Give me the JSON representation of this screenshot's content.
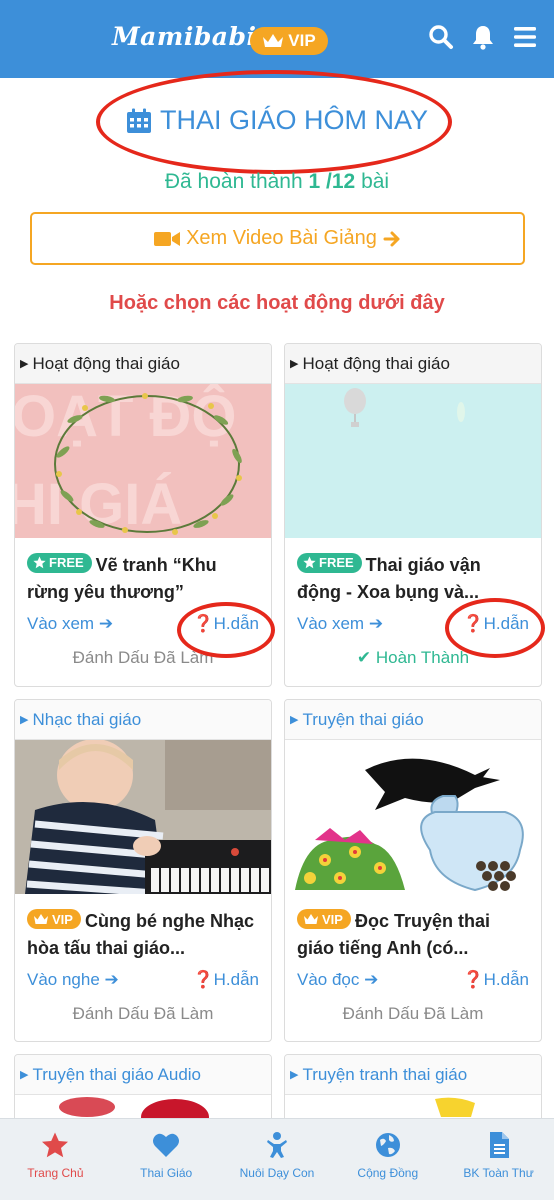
{
  "header": {
    "logo": "Mamibabi",
    "vip_label": "VIP",
    "icons": [
      "search-icon",
      "bell-icon",
      "menu-icon"
    ],
    "color": "#3d8fd9"
  },
  "today": {
    "title": "THAI GIÁO HÔM NAY",
    "progress_prefix": "Đã hoàn thành",
    "progress_value": "1 /12",
    "progress_suffix": "bài",
    "video_button": "Xem Video Bài Giảng",
    "choose_text": "Hoặc chọn các hoạt động dưới đây"
  },
  "cards": [
    {
      "category": "Hoạt động thai giáo",
      "badge": "FREE",
      "title": "Vẽ tranh “Khu rừng yêu thương”",
      "action": "Vào xem",
      "guide": "H.dẫn",
      "mark": "Đánh Dấu Đã Làm"
    },
    {
      "category": "Hoạt động thai giáo",
      "badge": "FREE",
      "title": "Thai giáo vận động - Xoa bụng và...",
      "action": "Vào xem",
      "guide": "H.dẫn",
      "mark": "Hoàn Thành"
    },
    {
      "category": "Nhạc thai giáo",
      "badge": "VIP",
      "title": "Cùng bé nghe Nhạc hòa tấu thai giáo...",
      "action": "Vào nghe",
      "guide": "H.dẫn",
      "mark": "Đánh Dấu Đã Làm"
    },
    {
      "category": "Truyện thai giáo",
      "badge": "VIP",
      "title": "Đọc Truyện thai giáo tiếng Anh (có...",
      "action": "Vào đọc",
      "guide": "H.dẫn",
      "mark": "Đánh Dấu Đã Làm"
    },
    {
      "category": "Truyện thai giáo Audio"
    },
    {
      "category": "Truyện tranh thai giáo"
    }
  ],
  "bottom_nav": [
    {
      "label": "Trang Chủ",
      "icon": "star-icon",
      "active": true
    },
    {
      "label": "Thai Giáo",
      "icon": "heart-icon"
    },
    {
      "label": "Nuôi Dạy Con",
      "icon": "baby-icon"
    },
    {
      "label": "Cộng Đồng",
      "icon": "globe-icon"
    },
    {
      "label": "BK Toàn Thư",
      "icon": "document-icon"
    }
  ],
  "colors": {
    "primary": "#3d8fd9",
    "accent": "#f5a623",
    "success": "#2fb892",
    "alert": "#e04a4a",
    "annotation": "#e5281b"
  }
}
